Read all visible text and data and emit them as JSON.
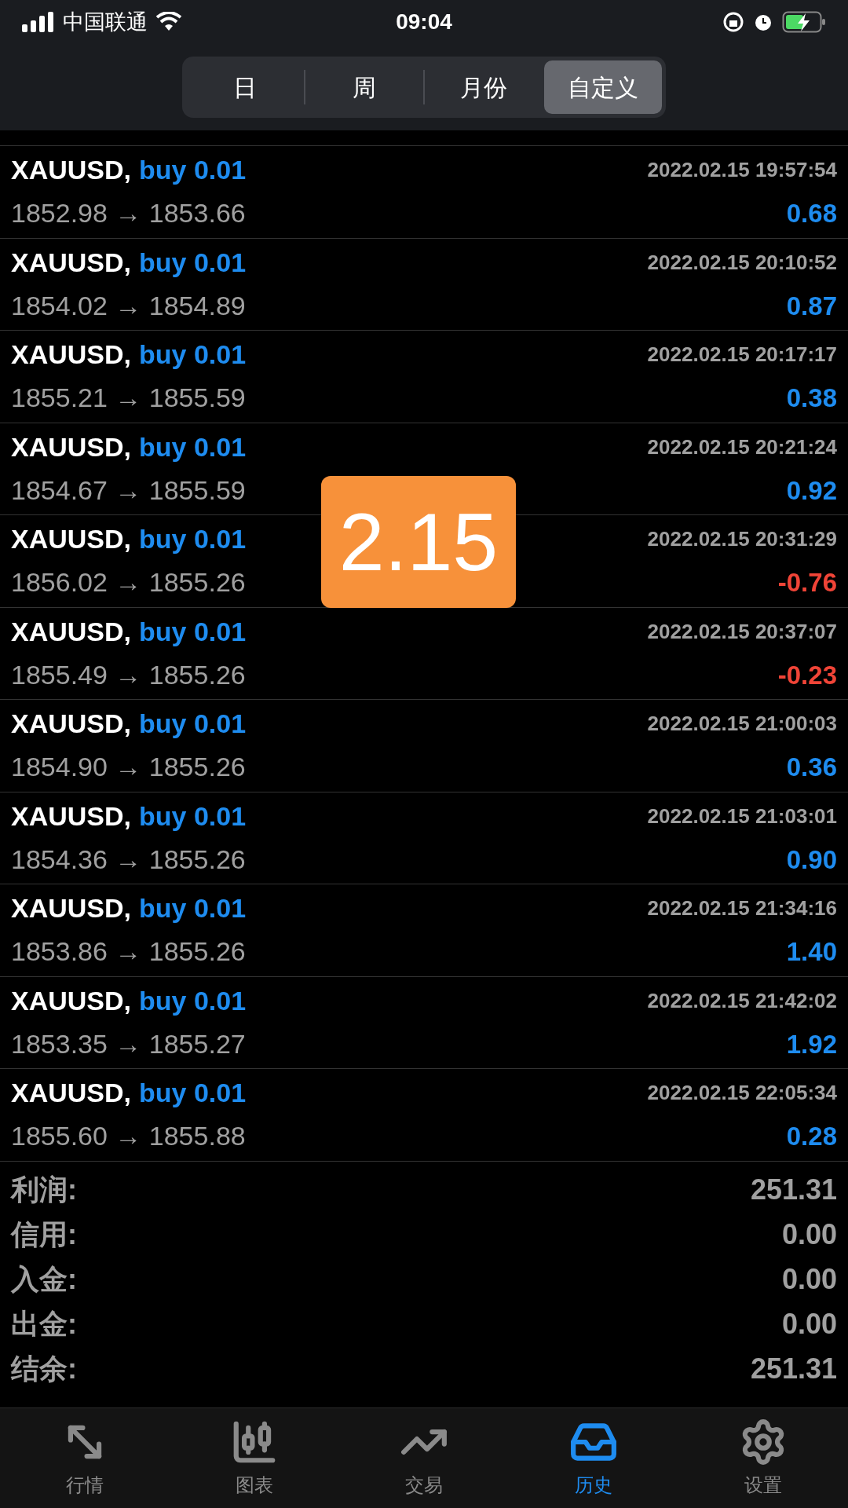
{
  "status_bar": {
    "carrier": "中国联通",
    "time": "09:04"
  },
  "period_tabs": [
    {
      "label": "日",
      "selected": false
    },
    {
      "label": "周",
      "selected": false
    },
    {
      "label": "月份",
      "selected": false
    },
    {
      "label": "自定义",
      "selected": true
    }
  ],
  "deals": [
    {
      "symbol": "XAUUSD,",
      "side": "buy 0.01",
      "time": "2022.02.15 19:57:54",
      "prices": "1852.98 → 1853.66",
      "profit": "0.68",
      "negative": false
    },
    {
      "symbol": "XAUUSD,",
      "side": "buy 0.01",
      "time": "2022.02.15 20:10:52",
      "prices": "1854.02 → 1854.89",
      "profit": "0.87",
      "negative": false
    },
    {
      "symbol": "XAUUSD,",
      "side": "buy 0.01",
      "time": "2022.02.15 20:17:17",
      "prices": "1855.21 → 1855.59",
      "profit": "0.38",
      "negative": false
    },
    {
      "symbol": "XAUUSD,",
      "side": "buy 0.01",
      "time": "2022.02.15 20:21:24",
      "prices": "1854.67 → 1855.59",
      "profit": "0.92",
      "negative": false
    },
    {
      "symbol": "XAUUSD,",
      "side": "buy 0.01",
      "time": "2022.02.15 20:31:29",
      "prices": "1856.02 → 1855.26",
      "profit": "-0.76",
      "negative": true
    },
    {
      "symbol": "XAUUSD,",
      "side": "buy 0.01",
      "time": "2022.02.15 20:37:07",
      "prices": "1855.49 → 1855.26",
      "profit": "-0.23",
      "negative": true
    },
    {
      "symbol": "XAUUSD,",
      "side": "buy 0.01",
      "time": "2022.02.15 21:00:03",
      "prices": "1854.90 → 1855.26",
      "profit": "0.36",
      "negative": false
    },
    {
      "symbol": "XAUUSD,",
      "side": "buy 0.01",
      "time": "2022.02.15 21:03:01",
      "prices": "1854.36 → 1855.26",
      "profit": "0.90",
      "negative": false
    },
    {
      "symbol": "XAUUSD,",
      "side": "buy 0.01",
      "time": "2022.02.15 21:34:16",
      "prices": "1853.86 → 1855.26",
      "profit": "1.40",
      "negative": false
    },
    {
      "symbol": "XAUUSD,",
      "side": "buy 0.01",
      "time": "2022.02.15 21:42:02",
      "prices": "1853.35 → 1855.27",
      "profit": "1.92",
      "negative": false
    },
    {
      "symbol": "XAUUSD,",
      "side": "buy 0.01",
      "time": "2022.02.15 22:05:34",
      "prices": "1855.60 → 1855.88",
      "profit": "0.28",
      "negative": false
    }
  ],
  "summary": [
    {
      "label": "利润:",
      "value": "251.31"
    },
    {
      "label": "信用:",
      "value": "0.00"
    },
    {
      "label": "入金:",
      "value": "0.00"
    },
    {
      "label": "出金:",
      "value": "0.00"
    },
    {
      "label": "结余:",
      "value": "251.31"
    }
  ],
  "overlay_label": "2.15",
  "bottom_tabs": [
    {
      "label": "行情",
      "kind": "quotes",
      "selected": false
    },
    {
      "label": "图表",
      "kind": "chart",
      "selected": false
    },
    {
      "label": "交易",
      "kind": "trade",
      "selected": false
    },
    {
      "label": "历史",
      "kind": "history",
      "selected": true
    },
    {
      "label": "设置",
      "kind": "settings",
      "selected": false
    }
  ]
}
